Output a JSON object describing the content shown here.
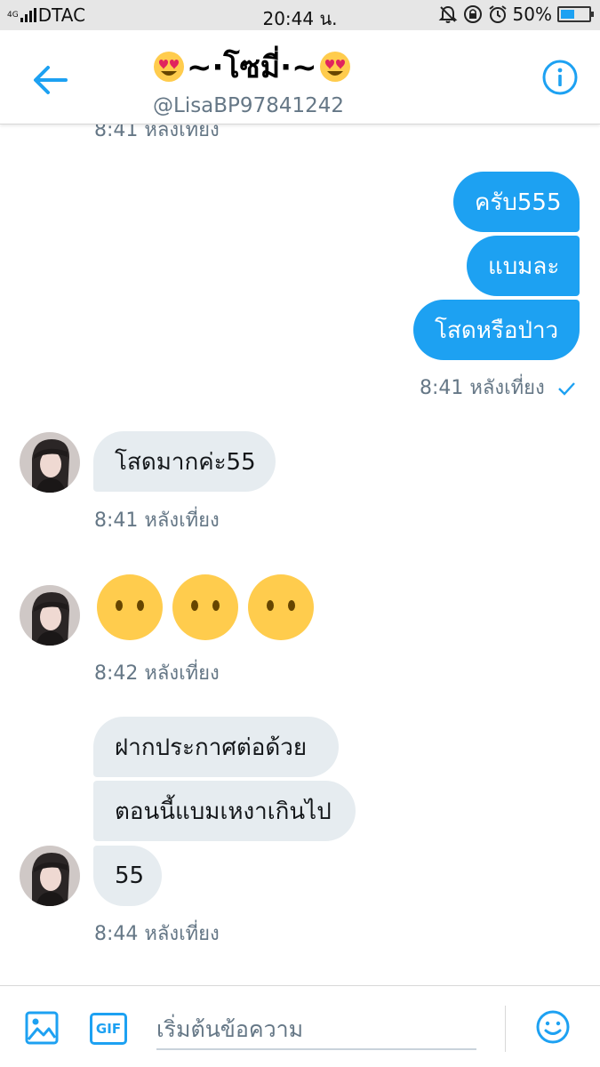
{
  "status_bar": {
    "network": "4G",
    "carrier": "DTAC",
    "time": "20:44 น.",
    "battery_percent": "50%",
    "battery_level": 0.5
  },
  "header": {
    "name": "~·โซมี่·~",
    "handle": "@LisaBP97841242",
    "back_icon": "arrow-left-icon",
    "info_icon": "info-icon"
  },
  "messages": {
    "top_cut_timestamp": "8:41 หลังเที่ยง",
    "sent_1": "ครับ555",
    "sent_2": "แบมละ",
    "sent_3": "โสดหรือป่าว",
    "sent_timestamp": "8:41 หลังเที่ยง",
    "recv_1": "โสดมากค่ะ55",
    "recv_1_timestamp": "8:41 หลังเที่ยง",
    "recv_2_timestamp": "8:42 หลังเที่ยง",
    "recv_3": "ฝากประกาศต่อด้วย",
    "recv_4": "ตอนนี้แบมเหงาเกินไป",
    "recv_5": "55",
    "recv_3_timestamp": "8:44 หลังเที่ยง"
  },
  "composer": {
    "placeholder": "เริ่มต้นข้อความ",
    "gif_label": "GIF"
  },
  "colors": {
    "accent": "#1da1f2",
    "incoming_bubble": "#e6ecf0",
    "muted_text": "#657786"
  }
}
